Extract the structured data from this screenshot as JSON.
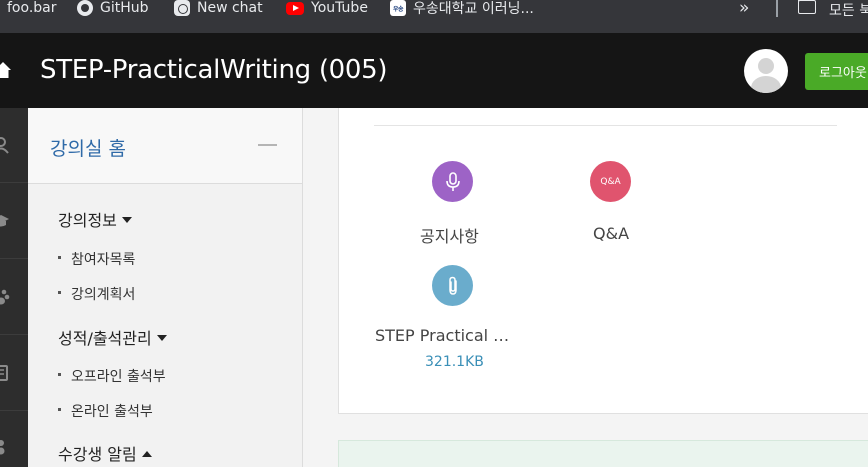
{
  "bookmarks": {
    "items": [
      {
        "label": "foo.bar",
        "icon": "none"
      },
      {
        "label": "GitHub",
        "icon": "github-icon"
      },
      {
        "label": "New chat",
        "icon": "openai-icon"
      },
      {
        "label": "YouTube",
        "icon": "youtube-icon"
      },
      {
        "label": "우송대학교 이러닝...",
        "icon": "woosong-icon"
      }
    ],
    "woosong_icon_text": "우송",
    "overflow": "»",
    "all_bookmarks_label": "모든 북"
  },
  "header": {
    "title": "STEP-PracticalWriting (005)",
    "logout_label": "로그아웃"
  },
  "sidebar": {
    "home_title": "강의실 홈",
    "sections": [
      {
        "title": "강의정보",
        "items": [
          "참여자목록",
          "강의계획서"
        ]
      },
      {
        "title": "성적/출석관리",
        "items": [
          "오프라인 출석부",
          "온라인 출석부"
        ]
      },
      {
        "title": "수강생 알림",
        "items": []
      }
    ]
  },
  "modules": [
    {
      "label": "공지사항",
      "icon": "microphone-icon",
      "color": "#9d63c6"
    },
    {
      "label": "Q&A",
      "icon": "qa-icon",
      "icon_text": "Q&A",
      "color": "#e0546e"
    },
    {
      "label": "STEP Practical …",
      "icon": "paperclip-icon",
      "color": "#6aaccc",
      "size": "321.1KB"
    }
  ],
  "colors": {
    "bookmark_bar": "#35363a",
    "header": "#151515",
    "logout": "#4aaa27",
    "link_blue": "#2f6aa8"
  }
}
